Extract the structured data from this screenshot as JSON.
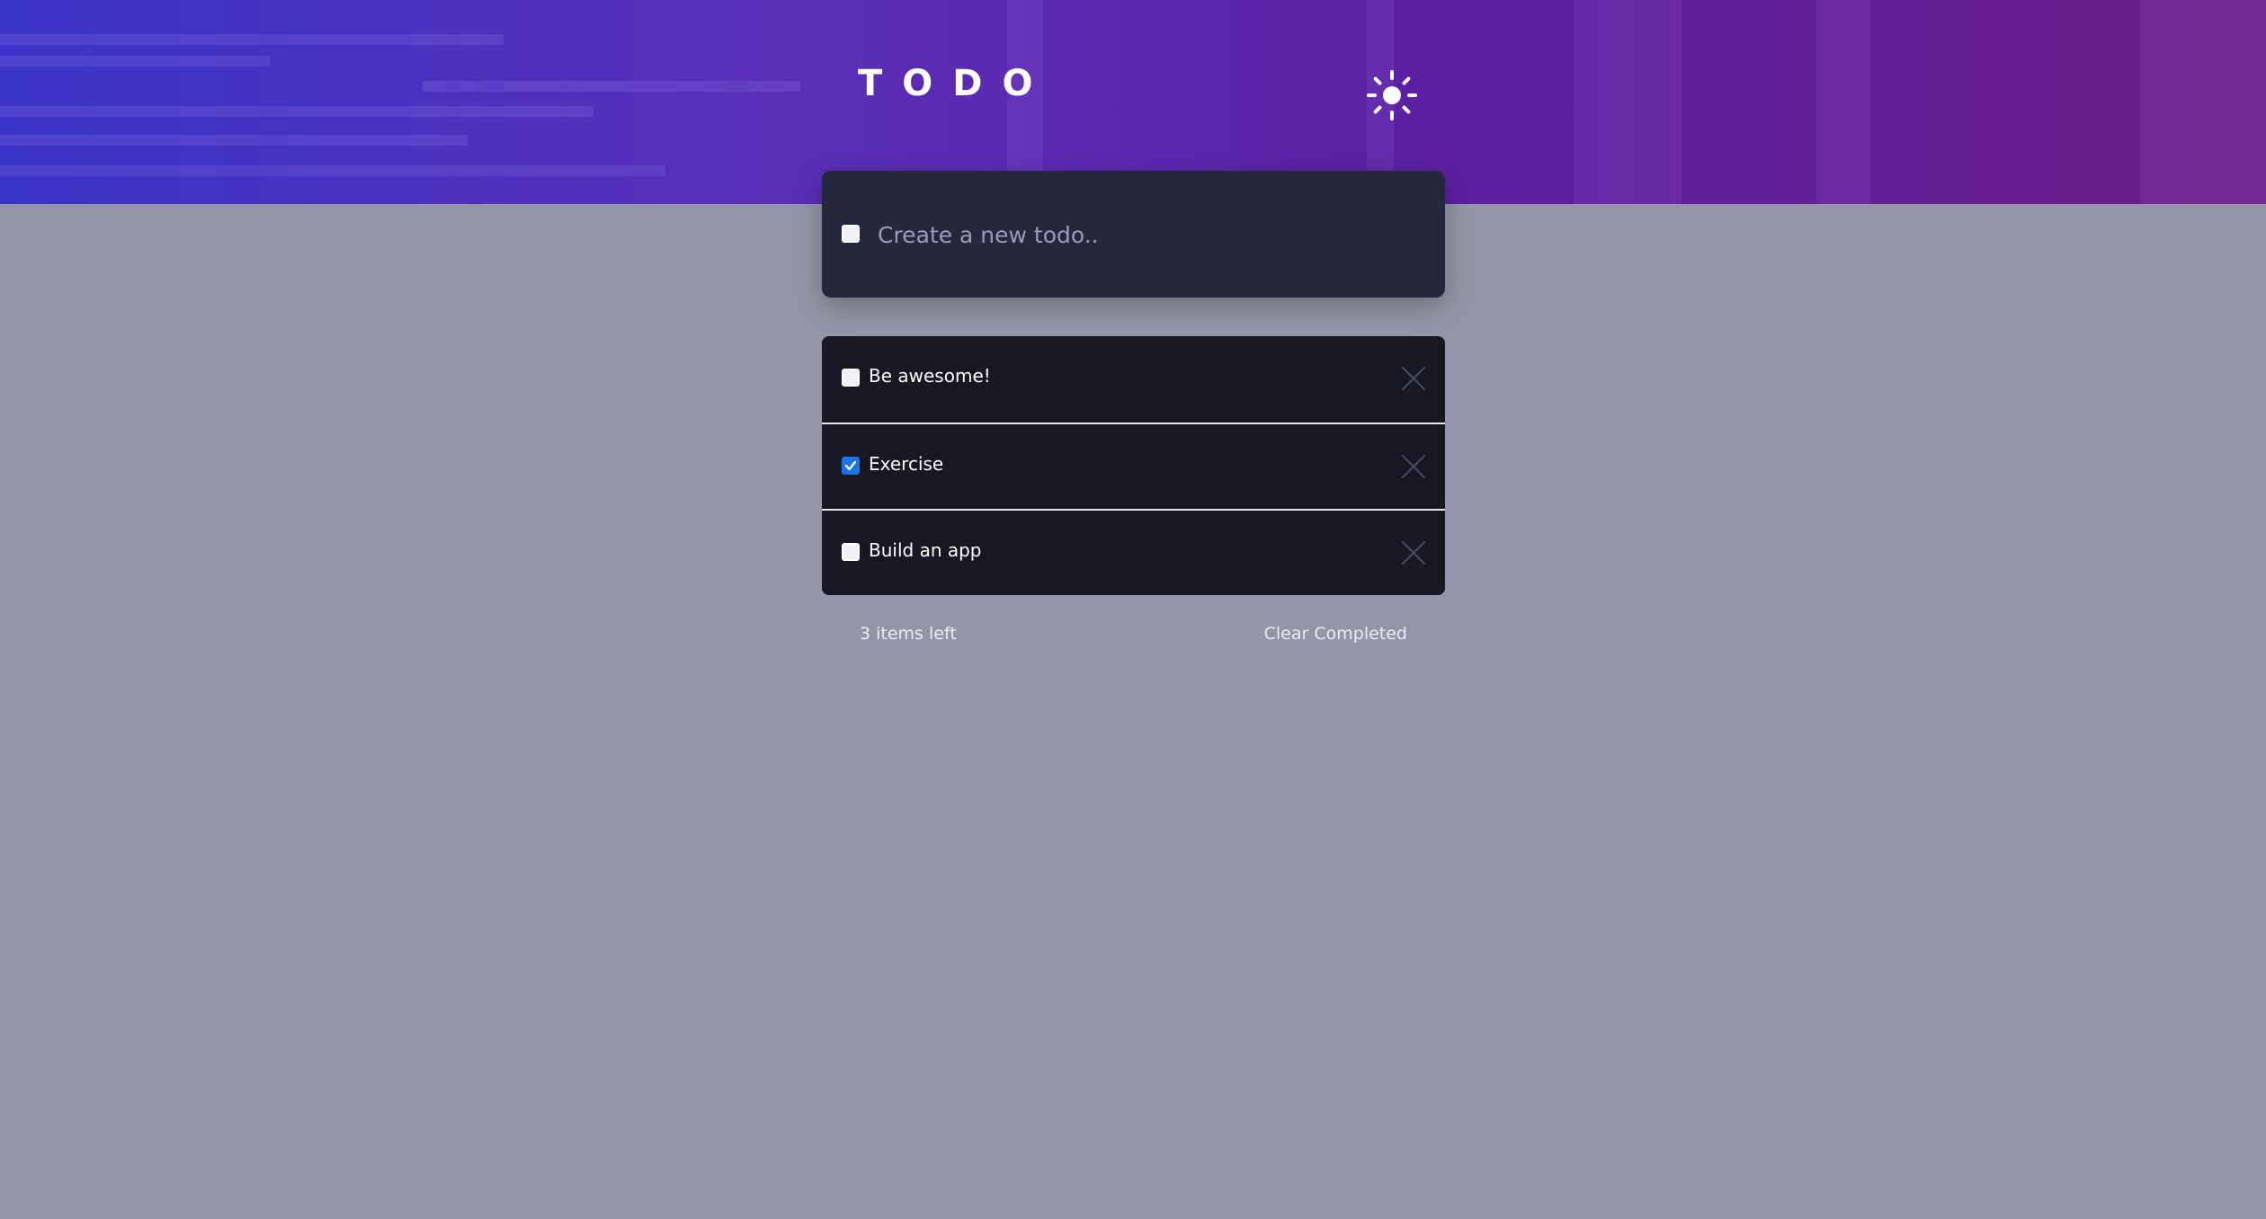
{
  "app": {
    "title": "TODO",
    "theme_toggle_icon": "sun-icon"
  },
  "new_todo": {
    "placeholder": "Create a new todo.."
  },
  "todos": [
    {
      "label": "Be awesome!",
      "completed": false
    },
    {
      "label": "Exercise",
      "completed": true
    },
    {
      "label": "Build an app",
      "completed": false
    }
  ],
  "footer": {
    "items_left": "3 items left",
    "clear_completed": "Clear Completed"
  },
  "colors": {
    "accent_checked": "#1a73e8",
    "card_bg": "#25273c",
    "list_bg": "#171823",
    "page_bg": "#9495a6"
  }
}
